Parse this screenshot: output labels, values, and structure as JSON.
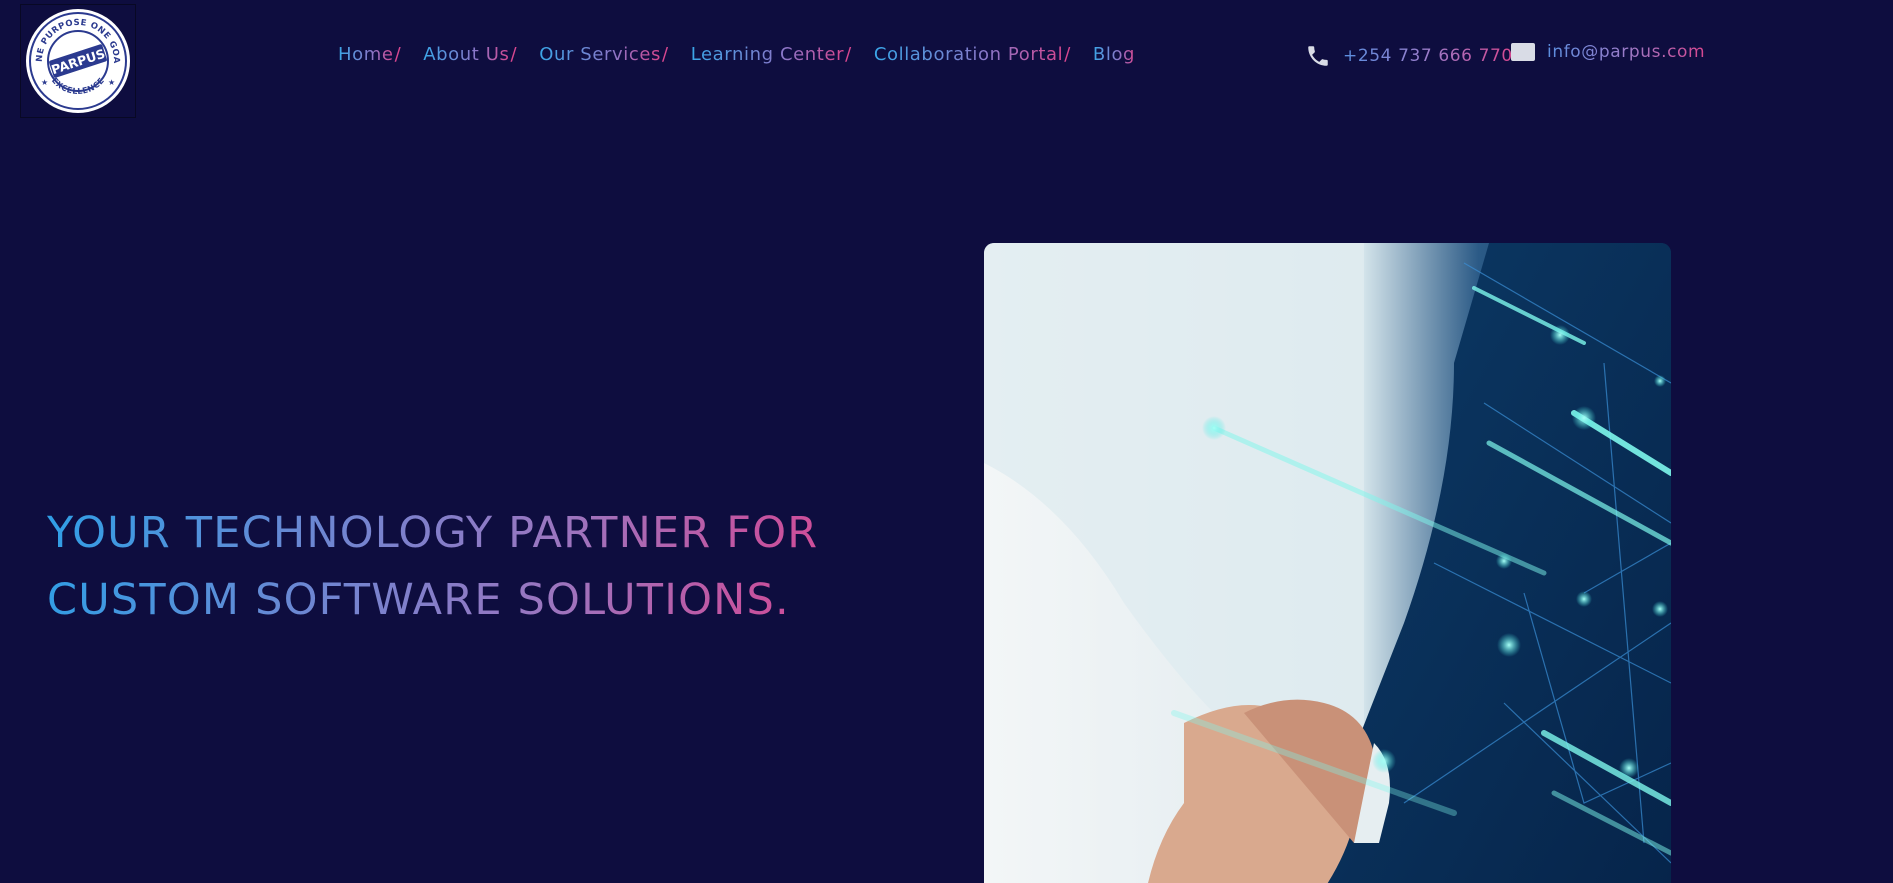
{
  "header": {
    "logo": {
      "icon": "parpus-logo-seal",
      "brand": "PARPUS",
      "ring_top": "ONE PURPOSE ONE GOAL",
      "ring_bottom": "EXCELLENCE"
    },
    "nav": [
      {
        "label": "Home",
        "separator": "/"
      },
      {
        "label": "About Us",
        "separator": "/"
      },
      {
        "label": "Our Services",
        "separator": "/"
      },
      {
        "label": "Learning Center",
        "separator": "/"
      },
      {
        "label": "Collaboration Portal",
        "separator": "/"
      },
      {
        "label": "Blog",
        "separator": ""
      }
    ],
    "contact": {
      "phone_icon": "phone-icon",
      "phone": "+254 737 666 770",
      "email_icon": "mail-icon",
      "email": "info@parpus.com"
    }
  },
  "hero": {
    "title": "YOUR TECHNOLOGY PARTNER FOR CUSTOM SOFTWARE SOLUTIONS.",
    "image": "handshake-network-image"
  },
  "colors": {
    "background": "#0e0d3f",
    "gradient_start": "#2f9fe6",
    "gradient_mid": "#9c75bf",
    "gradient_end": "#ea3f86"
  }
}
